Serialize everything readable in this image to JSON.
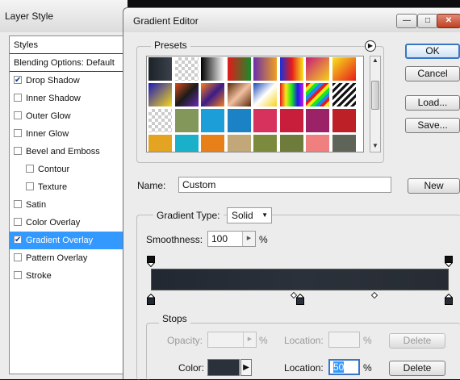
{
  "layer_style": {
    "title": "Layer Style",
    "items": [
      {
        "label": "Styles",
        "kind": "head"
      },
      {
        "label": "Blending Options: Default",
        "kind": "head"
      },
      {
        "label": "Drop Shadow",
        "checked": true
      },
      {
        "label": "Inner Shadow",
        "checked": false
      },
      {
        "label": "Outer Glow",
        "checked": false
      },
      {
        "label": "Inner Glow",
        "checked": false
      },
      {
        "label": "Bevel and Emboss",
        "checked": false
      },
      {
        "label": "Contour",
        "checked": false,
        "sub": true
      },
      {
        "label": "Texture",
        "checked": false,
        "sub": true
      },
      {
        "label": "Satin",
        "checked": false
      },
      {
        "label": "Color Overlay",
        "checked": false
      },
      {
        "label": "Gradient Overlay",
        "checked": true,
        "selected": true
      },
      {
        "label": "Pattern Overlay",
        "checked": false
      },
      {
        "label": "Stroke",
        "checked": false
      }
    ]
  },
  "gradient_editor": {
    "title": "Gradient Editor",
    "presets_label": "Presets",
    "buttons": {
      "ok": "OK",
      "cancel": "Cancel",
      "load": "Load...",
      "save": "Save...",
      "new": "New"
    },
    "name_label": "Name:",
    "name_value": "Custom",
    "gradient_type_label": "Gradient Type:",
    "gradient_type_value": "Solid",
    "smoothness_label": "Smoothness:",
    "smoothness_value": "100",
    "percent": "%",
    "stops": {
      "title": "Stops",
      "opacity_label": "Opacity:",
      "location_label": "Location:",
      "color_label": "Color:",
      "delete_label": "Delete",
      "color_location_value": "50",
      "color_swatch": "#2b313a"
    },
    "gradient_colors": [
      "#222831",
      "#2b313a",
      "#272c34"
    ],
    "color_stops_pct": [
      0,
      50,
      100
    ],
    "opacity_stops_pct": [
      0,
      100
    ],
    "midpoints_pct": [
      48,
      75
    ]
  },
  "presets": [
    "linear-gradient(90deg,#1d2228,#3a424b)",
    "repeating-conic-gradient(#ccc 0 25%,#fff 0 50%) 0 0/8px 8px",
    "linear-gradient(90deg,#000,#fff)",
    "linear-gradient(90deg,#e31b1b,#1a8a2a)",
    "linear-gradient(90deg,#6b2fa8,#f0a020)",
    "linear-gradient(90deg,#1b2fd8,#e61b1b,#f7e61b)",
    "linear-gradient(135deg,#c71b7a,#f7d21b)",
    "linear-gradient(135deg,#f7e41b,#e81b1b)",
    "linear-gradient(135deg,#1b1bb8,#f7d81b)",
    "linear-gradient(135deg,#d84a1b,#1b1b1b,#6b2ab8)",
    "linear-gradient(135deg,#f7801b,#3b1b8a,#f7801b)",
    "linear-gradient(135deg,#5a2a0a,#f0c0a0,#5a2a0a)",
    "linear-gradient(135deg,#1b4ab8,#fff,#f7d21b)",
    "linear-gradient(90deg,#e61b1b,#f7e61b,#1be61b,#1b1be6,#c81be6)",
    "repeating-linear-gradient(135deg,#e61b1b 0 4px,#f7e61b 4px 8px,#1be61b 8px 12px,#1b8af7 12px 16px)",
    "repeating-linear-gradient(135deg,#111 0 3px,#fff 3px 6px)",
    "repeating-conic-gradient(#ccc 0 25%,#fff 0 50%) 0 0/8px 8px",
    "#84975b",
    "#1c9fd9",
    "#1b82c6",
    "#d7315e",
    "#c81e3c",
    "#9b2267",
    "#bd2027",
    "#e4a321",
    "#1ab0c9",
    "#e8801a",
    "#c2a878",
    "#7c8a3e",
    "#6d7c3a",
    "#f07f80",
    "#5e6558",
    "#5a8c99"
  ]
}
